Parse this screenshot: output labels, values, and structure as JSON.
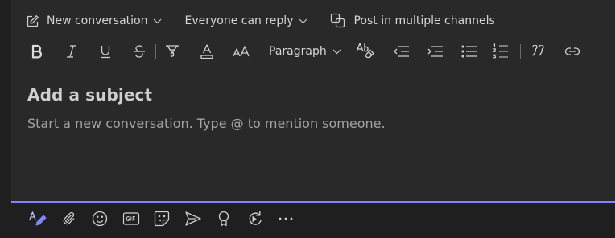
{
  "topbar": {
    "new_conversation": "New conversation",
    "reply_setting": "Everyone can reply",
    "post_multiple": "Post in multiple channels"
  },
  "format": {
    "paragraph": "Paragraph"
  },
  "compose": {
    "subject_placeholder": "Add a subject",
    "body_placeholder": "Start a new conversation. Type @ to mention someone."
  },
  "colors": {
    "background": "#1f1f1f",
    "compose_bg": "#292929",
    "accent": "#7f85f5"
  }
}
